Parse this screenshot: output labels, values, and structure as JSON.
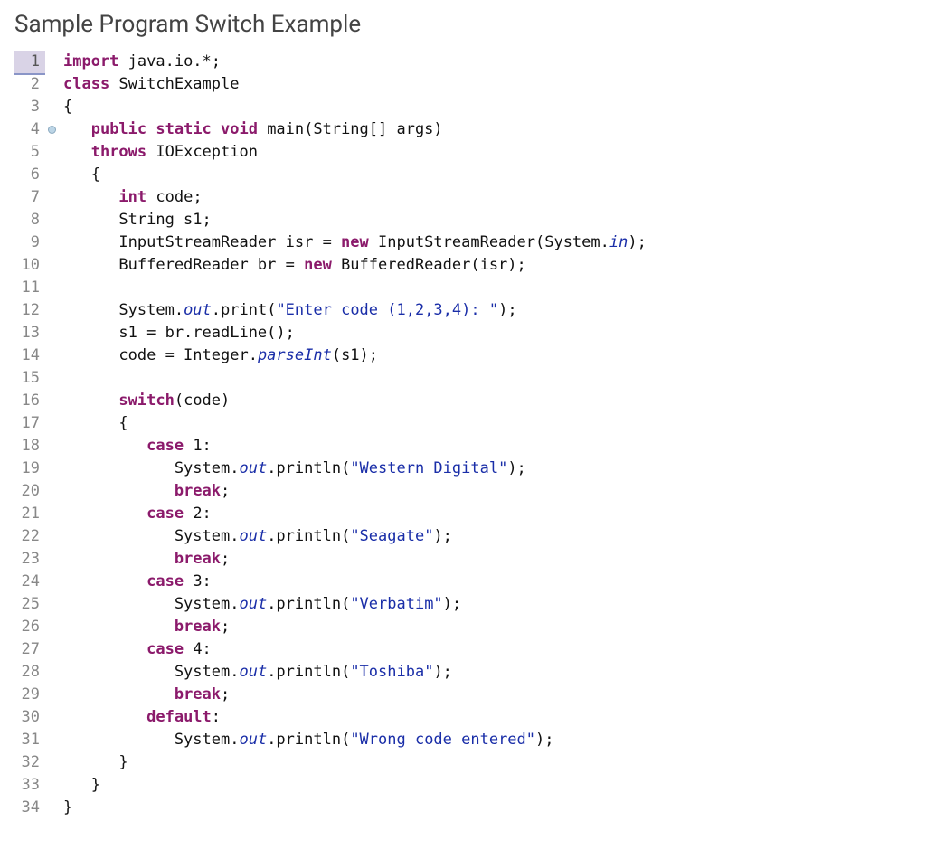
{
  "title": "Sample Program Switch Example",
  "lines": [
    {
      "n": "1",
      "cur": true,
      "marker": false,
      "segs": [
        {
          "t": "import",
          "c": "kw"
        },
        {
          "t": " java.io.*;",
          "c": "pln"
        }
      ]
    },
    {
      "n": "2",
      "cur": false,
      "marker": false,
      "segs": [
        {
          "t": "class",
          "c": "kw"
        },
        {
          "t": " SwitchExample",
          "c": "pln"
        }
      ]
    },
    {
      "n": "3",
      "cur": false,
      "marker": false,
      "segs": [
        {
          "t": "{",
          "c": "pln"
        }
      ]
    },
    {
      "n": "4",
      "cur": false,
      "marker": true,
      "segs": [
        {
          "t": "   ",
          "c": "pln"
        },
        {
          "t": "public static void",
          "c": "kw"
        },
        {
          "t": " main(String[] args)",
          "c": "pln"
        }
      ]
    },
    {
      "n": "5",
      "cur": false,
      "marker": false,
      "segs": [
        {
          "t": "   ",
          "c": "pln"
        },
        {
          "t": "throws",
          "c": "kw"
        },
        {
          "t": " IOException",
          "c": "pln"
        }
      ]
    },
    {
      "n": "6",
      "cur": false,
      "marker": false,
      "segs": [
        {
          "t": "   {",
          "c": "pln"
        }
      ]
    },
    {
      "n": "7",
      "cur": false,
      "marker": false,
      "segs": [
        {
          "t": "      ",
          "c": "pln"
        },
        {
          "t": "int",
          "c": "kw"
        },
        {
          "t": " code;",
          "c": "pln"
        }
      ]
    },
    {
      "n": "8",
      "cur": false,
      "marker": false,
      "segs": [
        {
          "t": "      String s1;",
          "c": "pln"
        }
      ]
    },
    {
      "n": "9",
      "cur": false,
      "marker": false,
      "segs": [
        {
          "t": "      InputStreamReader isr = ",
          "c": "pln"
        },
        {
          "t": "new",
          "c": "kw"
        },
        {
          "t": " InputStreamReader(System.",
          "c": "pln"
        },
        {
          "t": "in",
          "c": "fld"
        },
        {
          "t": ");",
          "c": "pln"
        }
      ]
    },
    {
      "n": "10",
      "cur": false,
      "marker": false,
      "segs": [
        {
          "t": "      BufferedReader br = ",
          "c": "pln"
        },
        {
          "t": "new",
          "c": "kw"
        },
        {
          "t": " BufferedReader(isr);",
          "c": "pln"
        }
      ]
    },
    {
      "n": "11",
      "cur": false,
      "marker": false,
      "segs": [
        {
          "t": "",
          "c": "pln"
        }
      ]
    },
    {
      "n": "12",
      "cur": false,
      "marker": false,
      "segs": [
        {
          "t": "      System.",
          "c": "pln"
        },
        {
          "t": "out",
          "c": "fld"
        },
        {
          "t": ".print(",
          "c": "pln"
        },
        {
          "t": "\"Enter code (1,2,3,4): \"",
          "c": "str"
        },
        {
          "t": ");",
          "c": "pln"
        }
      ]
    },
    {
      "n": "13",
      "cur": false,
      "marker": false,
      "segs": [
        {
          "t": "      s1 = br.readLine();",
          "c": "pln"
        }
      ]
    },
    {
      "n": "14",
      "cur": false,
      "marker": false,
      "segs": [
        {
          "t": "      code = Integer.",
          "c": "pln"
        },
        {
          "t": "parseInt",
          "c": "fld"
        },
        {
          "t": "(s1);",
          "c": "pln"
        }
      ]
    },
    {
      "n": "15",
      "cur": false,
      "marker": false,
      "segs": [
        {
          "t": "",
          "c": "pln"
        }
      ]
    },
    {
      "n": "16",
      "cur": false,
      "marker": false,
      "segs": [
        {
          "t": "      ",
          "c": "pln"
        },
        {
          "t": "switch",
          "c": "kw"
        },
        {
          "t": "(code)",
          "c": "pln"
        }
      ]
    },
    {
      "n": "17",
      "cur": false,
      "marker": false,
      "segs": [
        {
          "t": "      {",
          "c": "pln"
        }
      ]
    },
    {
      "n": "18",
      "cur": false,
      "marker": false,
      "segs": [
        {
          "t": "         ",
          "c": "pln"
        },
        {
          "t": "case",
          "c": "kw"
        },
        {
          "t": " 1:",
          "c": "pln"
        }
      ]
    },
    {
      "n": "19",
      "cur": false,
      "marker": false,
      "segs": [
        {
          "t": "            System.",
          "c": "pln"
        },
        {
          "t": "out",
          "c": "fld"
        },
        {
          "t": ".println(",
          "c": "pln"
        },
        {
          "t": "\"Western Digital\"",
          "c": "str"
        },
        {
          "t": ");",
          "c": "pln"
        }
      ]
    },
    {
      "n": "20",
      "cur": false,
      "marker": false,
      "segs": [
        {
          "t": "            ",
          "c": "pln"
        },
        {
          "t": "break",
          "c": "kw"
        },
        {
          "t": ";",
          "c": "pln"
        }
      ]
    },
    {
      "n": "21",
      "cur": false,
      "marker": false,
      "segs": [
        {
          "t": "         ",
          "c": "pln"
        },
        {
          "t": "case",
          "c": "kw"
        },
        {
          "t": " 2:",
          "c": "pln"
        }
      ]
    },
    {
      "n": "22",
      "cur": false,
      "marker": false,
      "segs": [
        {
          "t": "            System.",
          "c": "pln"
        },
        {
          "t": "out",
          "c": "fld"
        },
        {
          "t": ".println(",
          "c": "pln"
        },
        {
          "t": "\"Seagate\"",
          "c": "str"
        },
        {
          "t": ");",
          "c": "pln"
        }
      ]
    },
    {
      "n": "23",
      "cur": false,
      "marker": false,
      "segs": [
        {
          "t": "            ",
          "c": "pln"
        },
        {
          "t": "break",
          "c": "kw"
        },
        {
          "t": ";",
          "c": "pln"
        }
      ]
    },
    {
      "n": "24",
      "cur": false,
      "marker": false,
      "segs": [
        {
          "t": "         ",
          "c": "pln"
        },
        {
          "t": "case",
          "c": "kw"
        },
        {
          "t": " 3:",
          "c": "pln"
        }
      ]
    },
    {
      "n": "25",
      "cur": false,
      "marker": false,
      "segs": [
        {
          "t": "            System.",
          "c": "pln"
        },
        {
          "t": "out",
          "c": "fld"
        },
        {
          "t": ".println(",
          "c": "pln"
        },
        {
          "t": "\"Verbatim\"",
          "c": "str"
        },
        {
          "t": ");",
          "c": "pln"
        }
      ]
    },
    {
      "n": "26",
      "cur": false,
      "marker": false,
      "segs": [
        {
          "t": "            ",
          "c": "pln"
        },
        {
          "t": "break",
          "c": "kw"
        },
        {
          "t": ";",
          "c": "pln"
        }
      ]
    },
    {
      "n": "27",
      "cur": false,
      "marker": false,
      "segs": [
        {
          "t": "         ",
          "c": "pln"
        },
        {
          "t": "case",
          "c": "kw"
        },
        {
          "t": " 4:",
          "c": "pln"
        }
      ]
    },
    {
      "n": "28",
      "cur": false,
      "marker": false,
      "segs": [
        {
          "t": "            System.",
          "c": "pln"
        },
        {
          "t": "out",
          "c": "fld"
        },
        {
          "t": ".println(",
          "c": "pln"
        },
        {
          "t": "\"Toshiba\"",
          "c": "str"
        },
        {
          "t": ");",
          "c": "pln"
        }
      ]
    },
    {
      "n": "29",
      "cur": false,
      "marker": false,
      "segs": [
        {
          "t": "            ",
          "c": "pln"
        },
        {
          "t": "break",
          "c": "kw"
        },
        {
          "t": ";",
          "c": "pln"
        }
      ]
    },
    {
      "n": "30",
      "cur": false,
      "marker": false,
      "segs": [
        {
          "t": "         ",
          "c": "pln"
        },
        {
          "t": "default",
          "c": "kw"
        },
        {
          "t": ":",
          "c": "pln"
        }
      ]
    },
    {
      "n": "31",
      "cur": false,
      "marker": false,
      "segs": [
        {
          "t": "            System.",
          "c": "pln"
        },
        {
          "t": "out",
          "c": "fld"
        },
        {
          "t": ".println(",
          "c": "pln"
        },
        {
          "t": "\"Wrong code entered\"",
          "c": "str"
        },
        {
          "t": ");",
          "c": "pln"
        }
      ]
    },
    {
      "n": "32",
      "cur": false,
      "marker": false,
      "segs": [
        {
          "t": "      }",
          "c": "pln"
        }
      ]
    },
    {
      "n": "33",
      "cur": false,
      "marker": false,
      "segs": [
        {
          "t": "   }",
          "c": "pln"
        }
      ]
    },
    {
      "n": "34",
      "cur": false,
      "marker": false,
      "segs": [
        {
          "t": "}",
          "c": "pln"
        }
      ]
    }
  ]
}
